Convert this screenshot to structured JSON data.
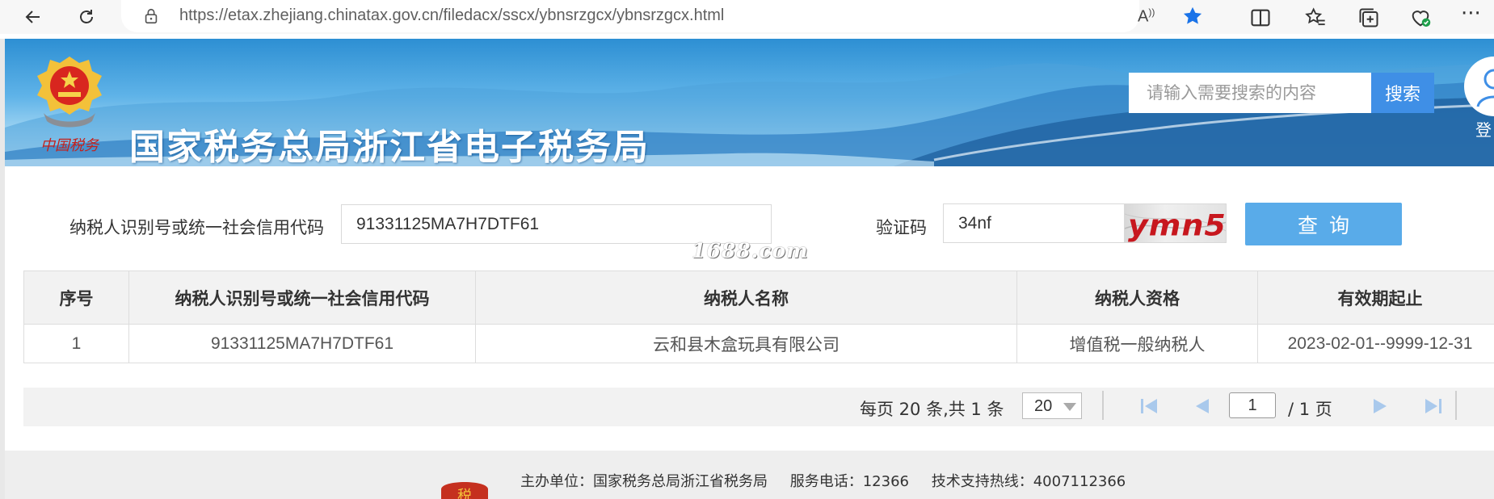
{
  "browser": {
    "url": "https://etax.zhejiang.chinatax.gov.cn/filedacx/sscx/ybnsrzgcx/ybnsrzgcx.html",
    "read_aloud_label": "A̩"
  },
  "header": {
    "title": "国家税务总局浙江省电子税务局",
    "search_placeholder": "请输入需要搜索的内容",
    "search_button": "搜索",
    "login_label": "登"
  },
  "form": {
    "tax_id_label": "纳税人识别号或统一社会信用代码",
    "tax_id_value": "91331125MA7H7DTF61",
    "captcha_label": "验证码",
    "captcha_value": "34nf",
    "captcha_image_text": "ymn5",
    "query_button": "查询",
    "watermark": "1688.com"
  },
  "table": {
    "headers": [
      "序号",
      "纳税人识别号或统一社会信用代码",
      "纳税人名称",
      "纳税人资格",
      "有效期起止"
    ],
    "rows": [
      [
        "1",
        "91331125MA7H7DTF61",
        "云和县木盒玩具有限公司",
        "增值税一般纳税人",
        "2023-02-01--9999-12-31"
      ]
    ]
  },
  "pager": {
    "summary": "每页 20 条,共 1 条",
    "page_size": "20",
    "current_page": "1",
    "total_pages": "/ 1 页"
  },
  "footer": {
    "sponsor": "主办单位：国家税务总局浙江省税务局",
    "phone": "服务电话：12366",
    "hotline": "技术支持热线：4007112366"
  },
  "colors": {
    "accent": "#3f8fe6",
    "query_button": "#59abe9",
    "captcha_text": "#c7171e"
  }
}
